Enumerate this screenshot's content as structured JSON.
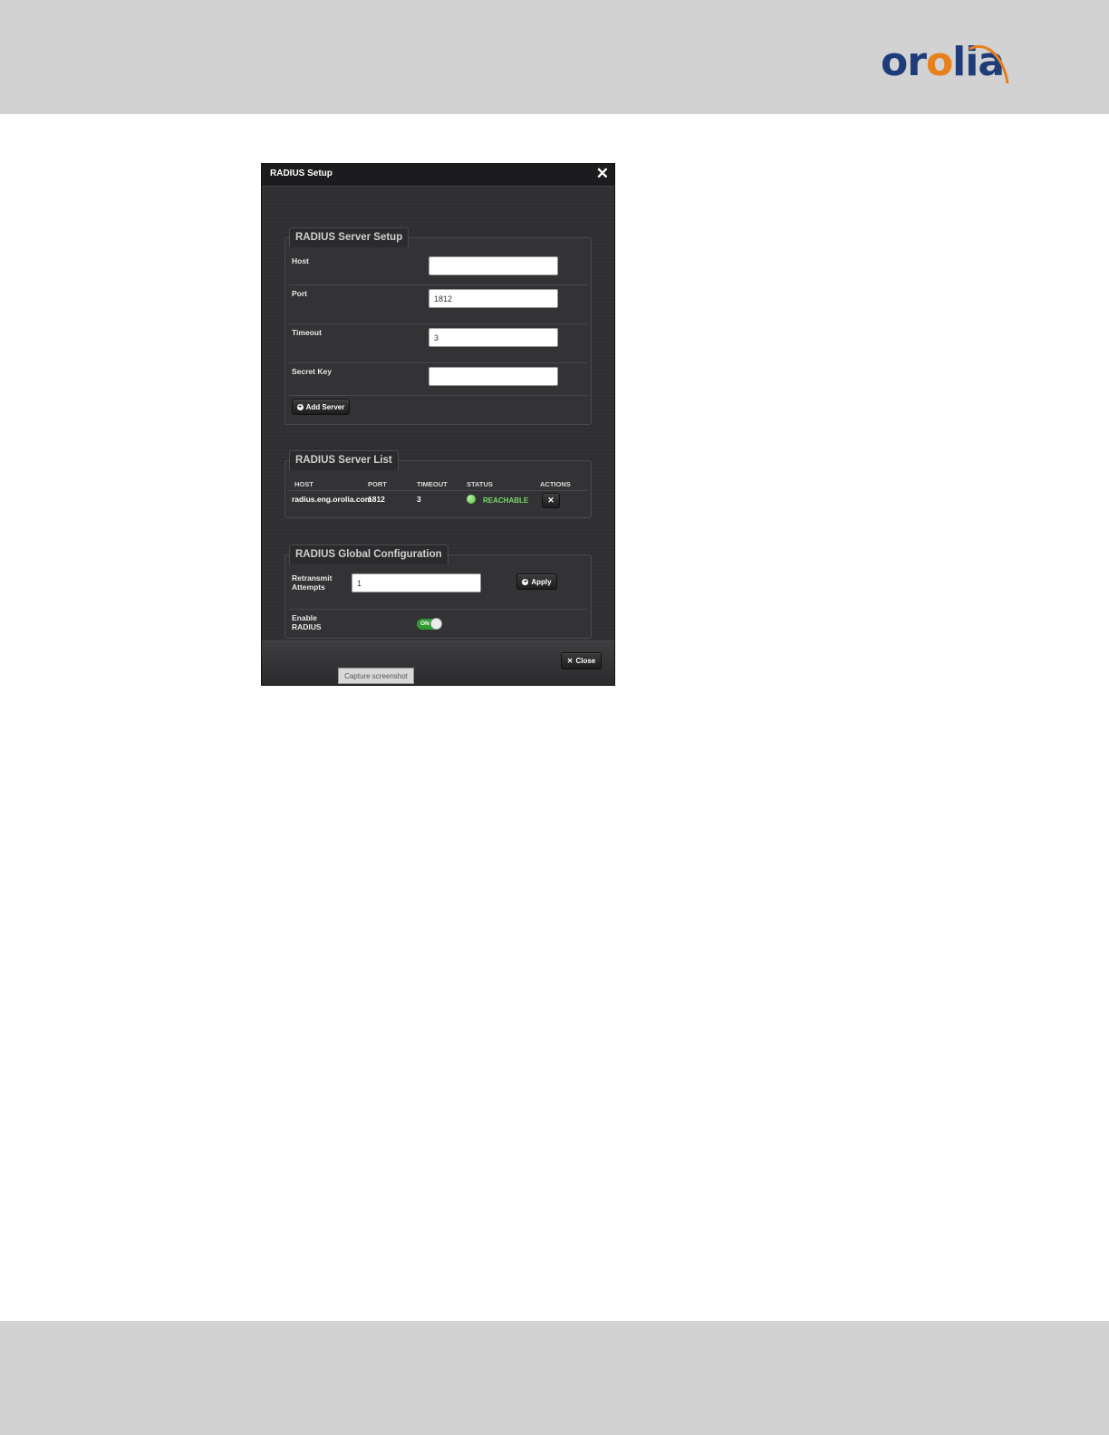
{
  "brand": {
    "logo_text_part1": "or",
    "logo_text_accent": "o",
    "logo_text_part2": "lia",
    "primary_color": "#1f3c7a",
    "accent_color": "#e8801e"
  },
  "modal": {
    "title": "RADIUS Setup",
    "close_icon": "close-x-icon"
  },
  "server_setup": {
    "legend": "RADIUS Server Setup",
    "host_label": "Host",
    "host_value": "",
    "port_label": "Port",
    "port_value": "1812",
    "timeout_label": "Timeout",
    "timeout_value": "3",
    "secret_label": "Secret Key",
    "secret_value": "",
    "add_button": "Add Server"
  },
  "server_list": {
    "legend": "RADIUS Server List",
    "columns": [
      "HOST",
      "PORT",
      "TIMEOUT",
      "STATUS",
      "ACTIONS"
    ],
    "rows": [
      {
        "host": "radius.eng.orolia.com",
        "port": "1812",
        "timeout": "3",
        "status": "REACHABLE",
        "action": "✕"
      }
    ],
    "status_color": "#7bd86a"
  },
  "global_config": {
    "legend": "RADIUS Global Configuration",
    "retransmit_label": "Retransmit Attempts",
    "retransmit_value": "1",
    "apply_button": "Apply",
    "enable_label": "Enable RADIUS",
    "toggle_label": "ON",
    "toggle_color": "#2f9a2f"
  },
  "footer": {
    "close_button": "Close",
    "capture_button": "Capture screenshot"
  }
}
